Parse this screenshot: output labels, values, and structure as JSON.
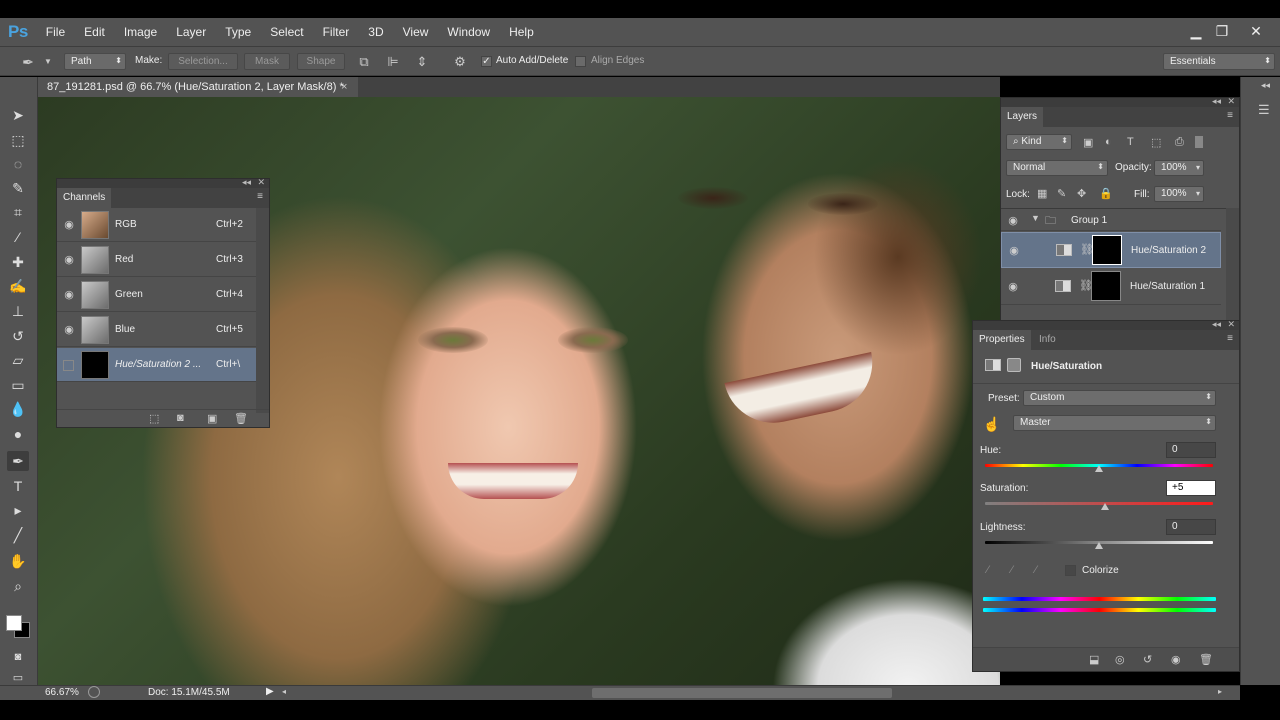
{
  "app": {
    "logo": "Ps"
  },
  "menu": [
    "File",
    "Edit",
    "Image",
    "Layer",
    "Type",
    "Select",
    "Filter",
    "3D",
    "View",
    "Window",
    "Help"
  ],
  "window_controls": {
    "minimize": "▁",
    "restore": "❐",
    "close": "✕"
  },
  "options": {
    "mode": "Path",
    "make_label": "Make:",
    "selection_btn": "Selection...",
    "mask_btn": "Mask",
    "shape_btn": "Shape",
    "auto_add_delete_label": "Auto Add/Delete",
    "auto_add_delete_checked": "✓",
    "align_edges_label": "Align Edges",
    "workspace": "Essentials"
  },
  "document": {
    "tab_title": "87_191281.psd @ 66.7% (Hue/Saturation 2, Layer Mask/8) *",
    "tab_close": "×"
  },
  "status": {
    "zoom": "66.67%",
    "doc_size": "Doc: 15.1M/45.5M"
  },
  "channels_panel": {
    "title": "Channels",
    "channels": [
      {
        "name": "RGB",
        "shortcut": "Ctrl+2",
        "eye": "◉"
      },
      {
        "name": "Red",
        "shortcut": "Ctrl+3",
        "eye": "◉"
      },
      {
        "name": "Green",
        "shortcut": "Ctrl+4",
        "eye": "◉"
      },
      {
        "name": "Blue",
        "shortcut": "Ctrl+5",
        "eye": "◉"
      },
      {
        "name": "Hue/Saturation 2 ...",
        "shortcut": "Ctrl+\\",
        "eye": ""
      }
    ]
  },
  "layers_panel": {
    "title": "Layers",
    "filter_kind": "Kind",
    "blend_mode": "Normal",
    "opacity_label": "Opacity:",
    "opacity_value": "100%",
    "lock_label": "Lock:",
    "fill_label": "Fill:",
    "fill_value": "100%",
    "layers": [
      {
        "name": "Group 1",
        "type": "group",
        "eye": "◉"
      },
      {
        "name": "Hue/Saturation 2",
        "type": "adjustment",
        "eye": "◉"
      },
      {
        "name": "Hue/Saturation 1",
        "type": "adjustment",
        "eye": "◉"
      }
    ]
  },
  "properties_panel": {
    "tabs": [
      "Properties",
      "Info"
    ],
    "adjustment_title": "Hue/Saturation",
    "preset_label": "Preset:",
    "preset_value": "Custom",
    "channel_value": "Master",
    "hue_label": "Hue:",
    "hue_value": "0",
    "saturation_label": "Saturation:",
    "saturation_value": "+5",
    "lightness_label": "Lightness:",
    "lightness_value": "0",
    "colorize_label": "Colorize"
  },
  "colors": {
    "accent": "#4aa3df",
    "panel_bg": "#535353",
    "selected_row": "#64748a"
  }
}
